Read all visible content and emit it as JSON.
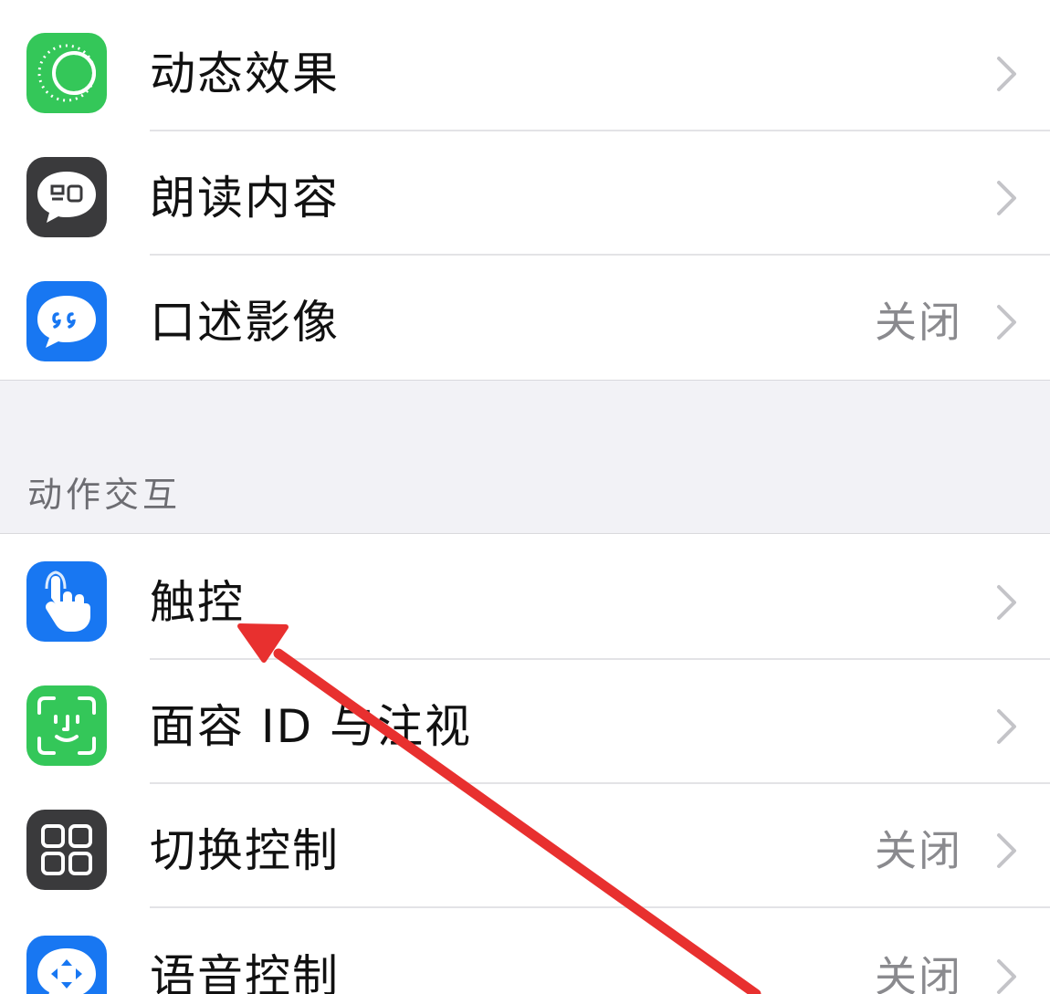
{
  "colors": {
    "green": "#34c759",
    "dark_gray": "#3a3a3c",
    "blue": "#1877f2",
    "annotation_red": "#e8302f",
    "secondary_text": "#8a8a8e",
    "section_header_text": "#6d6d72"
  },
  "vision_group": {
    "items": [
      {
        "label": "动态效果",
        "value": "",
        "icon": "motion-icon"
      },
      {
        "label": "朗读内容",
        "value": "",
        "icon": "speech-bubble-icon"
      },
      {
        "label": "口述影像",
        "value": "关闭",
        "icon": "audio-description-icon"
      }
    ]
  },
  "interaction_group": {
    "header": "动作交互",
    "items": [
      {
        "label": "触控",
        "value": "",
        "icon": "touch-hand-icon"
      },
      {
        "label": "面容 ID 与注视",
        "value": "",
        "icon": "face-id-icon"
      },
      {
        "label": "切换控制",
        "value": "关闭",
        "icon": "switch-control-icon"
      },
      {
        "label": "语音控制",
        "value": "关闭",
        "icon": "voice-control-icon"
      }
    ]
  },
  "annotation": {
    "type": "red-arrow",
    "points_to": "触控"
  }
}
